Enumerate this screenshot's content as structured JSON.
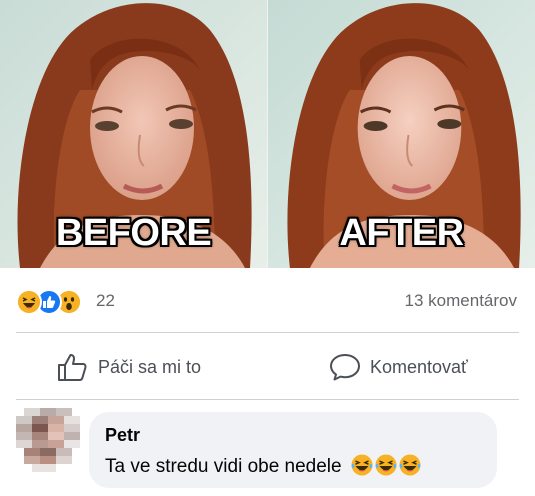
{
  "post": {
    "photos": [
      {
        "caption": "BEFORE"
      },
      {
        "caption": "AFTER"
      }
    ]
  },
  "reactions": {
    "icons": [
      "haha-icon",
      "like-icon",
      "wow-icon"
    ],
    "count": "22",
    "comment_count": "13 komentárov"
  },
  "actions": {
    "like_label": "Páči sa mi to",
    "comment_label": "Komentovať"
  },
  "comment": {
    "author": "Petr",
    "text": "Ta ve stredu vidi obe nedele",
    "emojis": [
      "laughing-emoji",
      "laughing-emoji",
      "laughing-emoji"
    ]
  },
  "colors": {
    "accent": "#1877f2",
    "reaction_yellow": "#f7b125",
    "muted_text": "#65676b",
    "bubble_bg": "#f0f2f5"
  }
}
